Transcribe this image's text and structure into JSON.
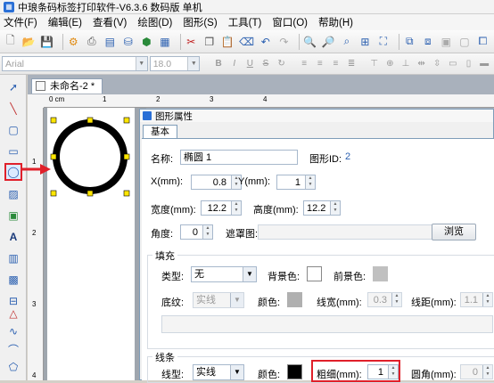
{
  "window": {
    "title": "中琅条码标签打印软件-V6.3.6 数码版 单机"
  },
  "menu": [
    "文件(F)",
    "编辑(E)",
    "查看(V)",
    "绘图(D)",
    "图形(S)",
    "工具(T)",
    "窗口(O)",
    "帮助(H)"
  ],
  "format_bar": {
    "font": "Arial",
    "size": "18.0"
  },
  "document": {
    "tab": "未命名-2 *",
    "ruler_labels": [
      "0 cm",
      "1",
      "2",
      "3",
      "4"
    ],
    "vruler_labels": [
      "1",
      "2",
      "3",
      "4"
    ]
  },
  "dialog": {
    "title": "图形属性",
    "tab": "基本",
    "name_label": "名称:",
    "name_value": "椭圆 1",
    "id_label": "图形ID:",
    "id_value": "2",
    "x_label": "X(mm):",
    "x_value": "0.8",
    "y_label": "Y(mm):",
    "y_value": "1",
    "width_label": "宽度(mm):",
    "width_value": "12.2",
    "height_label": "高度(mm):",
    "height_value": "12.2",
    "angle_label": "角度:",
    "angle_value": "0",
    "mask_label": "遮罩图:",
    "browse_label": "浏览",
    "fill": {
      "group": "填充",
      "type_label": "类型:",
      "type_value": "无",
      "bg_label": "背景色:",
      "fg_label": "前景色:",
      "pattern_label": "底纹:",
      "pattern_value": "实线",
      "color_label": "颜色:",
      "linewidth_label": "线宽(mm):",
      "linewidth_value": "0.3",
      "spacing_label": "线距(mm):",
      "spacing_value": "1.1"
    },
    "line": {
      "group": "线条",
      "type_label": "线型:",
      "type_value": "实线",
      "color_label": "颜色:",
      "thickness_label": "粗细(mm):",
      "thickness_value": "1",
      "radius_label": "圆角(mm):",
      "radius_value": "0"
    }
  },
  "colors": {
    "accent": "#2a6fd6",
    "highlight": "#e0202a"
  }
}
